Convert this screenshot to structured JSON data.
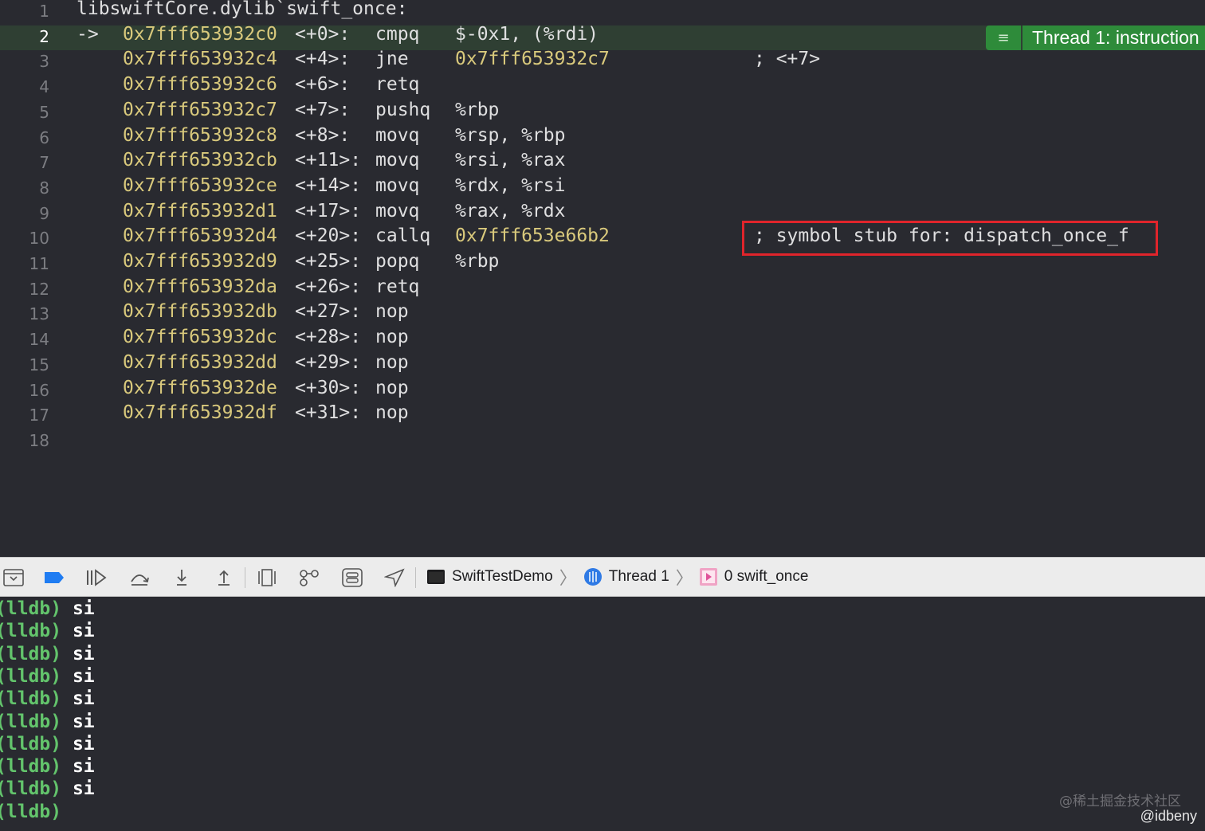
{
  "editor": {
    "header_line": {
      "num": "1",
      "text": "libswiftCore.dylib`swift_once:"
    },
    "pc_marker": "->",
    "lines": [
      {
        "num": "2",
        "addr": "0x7fff653932c0",
        "off": "<+0>:",
        "op": "cmpq",
        "args_addr": "",
        "args": "$-0x1, (%rdi)",
        "comment": ""
      },
      {
        "num": "3",
        "addr": "0x7fff653932c4",
        "off": "<+4>:",
        "op": "jne",
        "args_addr": "0x7fff653932c7",
        "args": "",
        "comment": "; <+7>"
      },
      {
        "num": "4",
        "addr": "0x7fff653932c6",
        "off": "<+6>:",
        "op": "retq",
        "args_addr": "",
        "args": "",
        "comment": ""
      },
      {
        "num": "5",
        "addr": "0x7fff653932c7",
        "off": "<+7>:",
        "op": "pushq",
        "args_addr": "",
        "args": "%rbp",
        "comment": ""
      },
      {
        "num": "6",
        "addr": "0x7fff653932c8",
        "off": "<+8>:",
        "op": "movq",
        "args_addr": "",
        "args": "%rsp, %rbp",
        "comment": ""
      },
      {
        "num": "7",
        "addr": "0x7fff653932cb",
        "off": "<+11>:",
        "op": "movq",
        "args_addr": "",
        "args": "%rsi, %rax",
        "comment": ""
      },
      {
        "num": "8",
        "addr": "0x7fff653932ce",
        "off": "<+14>:",
        "op": "movq",
        "args_addr": "",
        "args": "%rdx, %rsi",
        "comment": ""
      },
      {
        "num": "9",
        "addr": "0x7fff653932d1",
        "off": "<+17>:",
        "op": "movq",
        "args_addr": "",
        "args": "%rax, %rdx",
        "comment": ""
      },
      {
        "num": "10",
        "addr": "0x7fff653932d4",
        "off": "<+20>:",
        "op": "callq",
        "args_addr": "0x7fff653e66b2",
        "args": "",
        "comment": "; symbol stub for: dispatch_once_f"
      },
      {
        "num": "11",
        "addr": "0x7fff653932d9",
        "off": "<+25>:",
        "op": "popq",
        "args_addr": "",
        "args": "%rbp",
        "comment": ""
      },
      {
        "num": "12",
        "addr": "0x7fff653932da",
        "off": "<+26>:",
        "op": "retq",
        "args_addr": "",
        "args": "",
        "comment": ""
      },
      {
        "num": "13",
        "addr": "0x7fff653932db",
        "off": "<+27>:",
        "op": "nop",
        "args_addr": "",
        "args": "",
        "comment": ""
      },
      {
        "num": "14",
        "addr": "0x7fff653932dc",
        "off": "<+28>:",
        "op": "nop",
        "args_addr": "",
        "args": "",
        "comment": ""
      },
      {
        "num": "15",
        "addr": "0x7fff653932dd",
        "off": "<+29>:",
        "op": "nop",
        "args_addr": "",
        "args": "",
        "comment": ""
      },
      {
        "num": "16",
        "addr": "0x7fff653932de",
        "off": "<+30>:",
        "op": "nop",
        "args_addr": "",
        "args": "",
        "comment": ""
      },
      {
        "num": "17",
        "addr": "0x7fff653932df",
        "off": "<+31>:",
        "op": "nop",
        "args_addr": "",
        "args": "",
        "comment": ""
      },
      {
        "num": "18",
        "addr": "",
        "off": "",
        "op": "",
        "args_addr": "",
        "args": "",
        "comment": ""
      }
    ],
    "badge_icon": "≡",
    "badge_text": "Thread 1: instruction"
  },
  "toolbar": {
    "icons": [
      "hide-debug-area-icon",
      "breakpoints-toggle-icon",
      "continue-icon",
      "step-over-icon",
      "step-into-icon",
      "step-out-icon",
      "view-debugger-icon",
      "memory-graph-icon",
      "environment-overrides-icon",
      "simulate-location-icon"
    ],
    "crumbs": [
      "SwiftTestDemo",
      "Thread 1",
      "0 swift_once"
    ]
  },
  "console": {
    "lines": [
      {
        "prompt": "(lldb)",
        "cmd": "si"
      },
      {
        "prompt": "(lldb)",
        "cmd": "si"
      },
      {
        "prompt": "(lldb)",
        "cmd": "si"
      },
      {
        "prompt": "(lldb)",
        "cmd": "si"
      },
      {
        "prompt": "(lldb)",
        "cmd": "si"
      },
      {
        "prompt": "(lldb)",
        "cmd": "si"
      },
      {
        "prompt": "(lldb)",
        "cmd": "si"
      },
      {
        "prompt": "(lldb)",
        "cmd": "si"
      },
      {
        "prompt": "(lldb)",
        "cmd": "si"
      },
      {
        "prompt": "(lldb)",
        "cmd": ""
      }
    ]
  },
  "watermark": {
    "site": "@稀土掘金技术社区",
    "author": "@idbeny"
  },
  "colors": {
    "address": "#d9c97c",
    "prompt": "#63c46c",
    "highlight_box": "#e0242b",
    "current_line": "#2f3f33",
    "badge": "#2e8b3a"
  }
}
